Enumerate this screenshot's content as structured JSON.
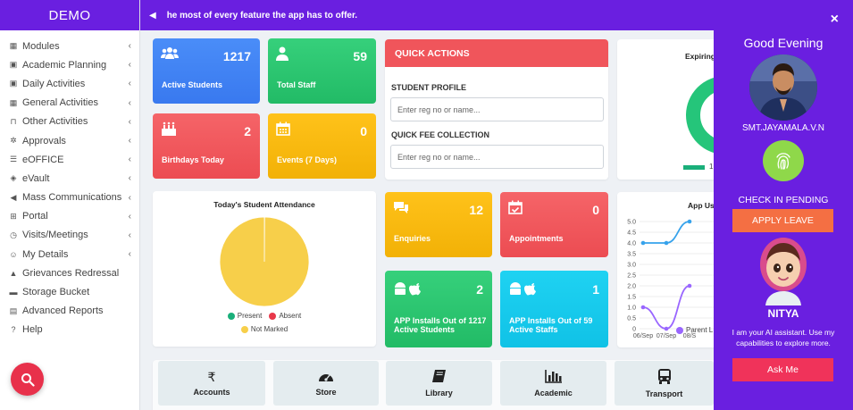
{
  "brand": "DEMO",
  "topbar": {
    "marquee": "he most of every feature the app has to offer."
  },
  "sidebar": {
    "items": [
      {
        "label": "Modules",
        "icon": "grid-icon",
        "chevron": true
      },
      {
        "label": "Academic Planning",
        "icon": "calendar-icon",
        "chevron": true
      },
      {
        "label": "Daily Activities",
        "icon": "calendar-icon",
        "chevron": true
      },
      {
        "label": "General Activities",
        "icon": "grid-icon",
        "chevron": true
      },
      {
        "label": "Other Activities",
        "icon": "bookmark-icon",
        "chevron": true
      },
      {
        "label": "Approvals",
        "icon": "gears-icon",
        "chevron": true
      },
      {
        "label": "eOFFICE",
        "icon": "list-icon",
        "chevron": true
      },
      {
        "label": "eVault",
        "icon": "shield-icon",
        "chevron": true
      },
      {
        "label": "Mass Communications",
        "icon": "megaphone-icon",
        "chevron": true
      },
      {
        "label": "Portal",
        "icon": "sliders-icon",
        "chevron": true
      },
      {
        "label": "Visits/Meetings",
        "icon": "clock-icon",
        "chevron": true
      },
      {
        "label": "My Details",
        "icon": "user-icon",
        "chevron": true
      },
      {
        "label": "Grievances Redressal",
        "icon": "fire-icon",
        "chevron": false
      },
      {
        "label": "Storage Bucket",
        "icon": "folder-icon",
        "chevron": false
      },
      {
        "label": "Advanced Reports",
        "icon": "report-icon",
        "chevron": false
      },
      {
        "label": "Help",
        "icon": "help-icon",
        "chevron": false
      }
    ]
  },
  "stats": {
    "active_students": {
      "value": "1217",
      "label": "Active Students"
    },
    "total_staff": {
      "value": "59",
      "label": "Total Staff"
    },
    "birthdays": {
      "value": "2",
      "label": "Birthdays Today"
    },
    "events": {
      "value": "0",
      "label": "Events (7 Days)"
    },
    "enquiries": {
      "value": "12",
      "label": "Enquiries"
    },
    "appointments": {
      "value": "0",
      "label": "Appointments"
    },
    "app_students": {
      "value": "2",
      "label": "APP Installs Out of 1217 Active Students"
    },
    "app_staffs": {
      "value": "1",
      "label": "APP Installs Out of 59 Active Staffs"
    }
  },
  "quick_actions": {
    "title": "QUICK ACTIONS",
    "student_profile": "STUDENT PROFILE",
    "student_placeholder": "Enter reg no or name...",
    "fee_collection": "QUICK FEE COLLECTION",
    "fee_placeholder": "Enter reg no or name..."
  },
  "expiring": {
    "title": "Expiring",
    "legend_text": "1"
  },
  "attendance": {
    "title": "Today's Student Attendance",
    "legend": [
      {
        "label": "Present",
        "color": "#1aaf7a"
      },
      {
        "label": "Absent",
        "color": "#e8384a"
      },
      {
        "label": "Not Marked",
        "color": "#f7cf4a"
      }
    ]
  },
  "app_usage": {
    "title": "App Us",
    "legend": "Parent L"
  },
  "chart_data": [
    {
      "type": "pie",
      "title": "Today's Student Attendance",
      "categories": [
        "Present",
        "Absent",
        "Not Marked"
      ],
      "values": [
        1,
        0,
        1216
      ]
    },
    {
      "type": "line",
      "title": "App Us",
      "x": [
        "06/Sep",
        "07/Sep",
        "08/S"
      ],
      "ylim": [
        0,
        5
      ],
      "yticks": [
        "0",
        "0.5",
        "1.0",
        "1.5",
        "2.0",
        "2.5",
        "3.0",
        "3.5",
        "4.0",
        "4.5",
        "5.0"
      ],
      "series": [
        {
          "color": "#36a2eb",
          "values": [
            4,
            4,
            5
          ]
        },
        {
          "name": "Parent L",
          "color": "#9966ff",
          "values": [
            1,
            0,
            2
          ]
        }
      ]
    }
  ],
  "tiles": [
    {
      "label": "Accounts",
      "icon": "rupee-icon"
    },
    {
      "label": "Store",
      "icon": "gauge-icon"
    },
    {
      "label": "Library",
      "icon": "book-icon"
    },
    {
      "label": "Academic",
      "icon": "bar-chart-icon"
    },
    {
      "label": "Transport",
      "icon": "bus-icon"
    }
  ],
  "right_panel": {
    "greeting": "Good Evening",
    "user_name": "SMT.JAYAMALA.V.N",
    "checkin_status": "CHECK IN PENDING",
    "apply_leave": "APPLY LEAVE",
    "assistant_name": "NITYA",
    "assistant_text": "I am your AI assistant. Use my capabilities to explore more.",
    "ask_me": "Ask Me",
    "close": "×"
  }
}
